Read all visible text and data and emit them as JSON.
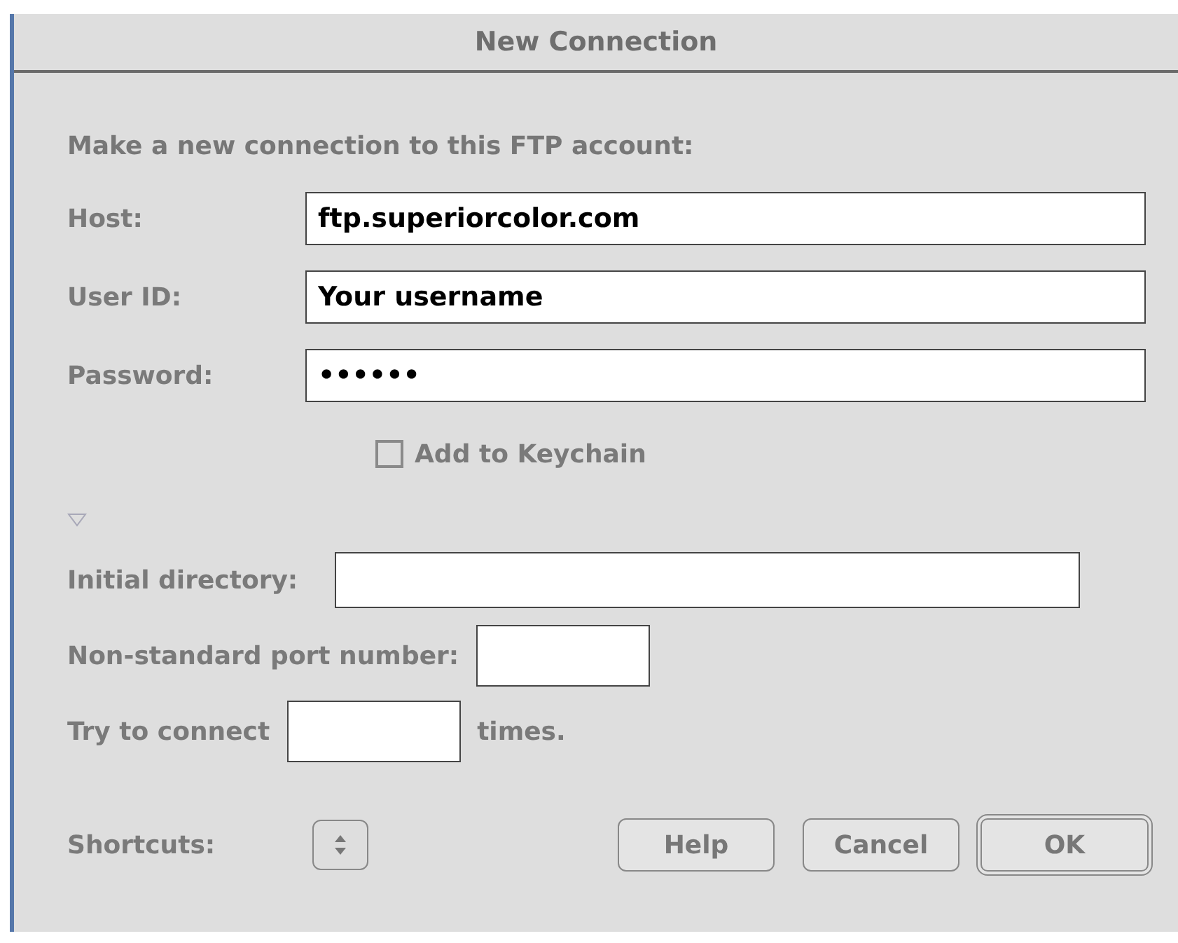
{
  "window": {
    "title": "New Connection"
  },
  "instruction": "Make a new connection to this FTP account:",
  "fields": [
    {
      "label": "Host:",
      "value": "ftp.superiorcolor.com"
    },
    {
      "label": "User ID:",
      "value": "Your username"
    },
    {
      "label": "Password:",
      "value": "••••••"
    }
  ],
  "keychain": {
    "label": "Add to Keychain",
    "checked": false
  },
  "options": {
    "expanded": true
  },
  "initial_directory": {
    "label": "Initial directory:"
  },
  "port": {
    "label": "Non-standard port number:"
  },
  "retries": {
    "label_before": "Try to connect",
    "label_after": "times."
  },
  "shortcuts": {
    "label": "Shortcuts:"
  },
  "buttons": [
    {
      "label": "Help",
      "default": false
    },
    {
      "label": "Cancel",
      "default": false
    },
    {
      "label": "OK",
      "default": true
    }
  ]
}
